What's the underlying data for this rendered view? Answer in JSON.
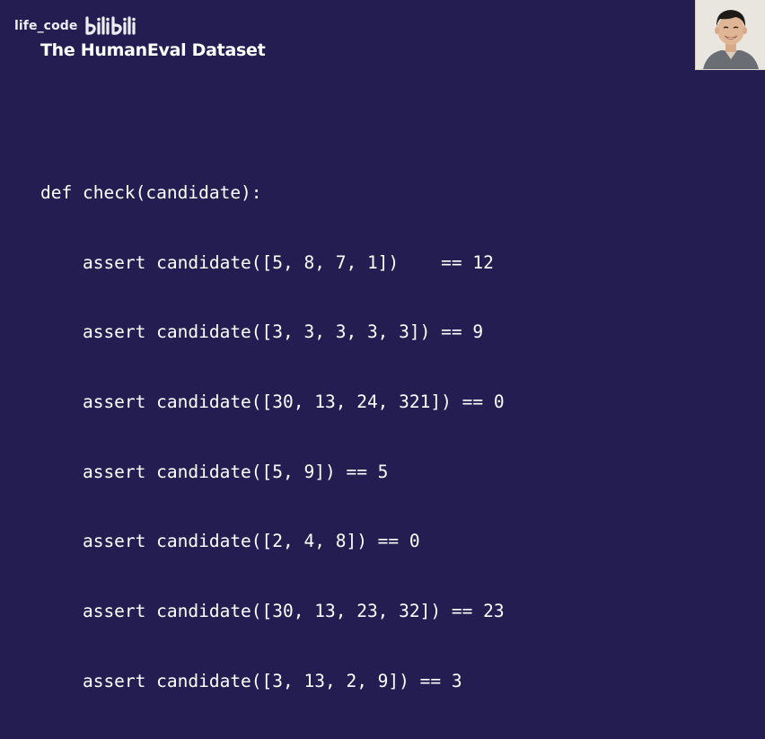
{
  "watermark": {
    "channel": "life_code",
    "logo_text": "bilibili"
  },
  "slide": {
    "title": "The HumanEval Dataset"
  },
  "code": {
    "lines": [
      "def check(candidate):",
      "    assert candidate([5, 8, 7, 1])    == 12",
      "    assert candidate([3, 3, 3, 3, 3]) == 9",
      "    assert candidate([30, 13, 24, 321]) == 0",
      "    assert candidate([5, 9]) == 5",
      "    assert candidate([2, 4, 8]) == 0",
      "    assert candidate([30, 13, 23, 32]) == 23",
      "    assert candidate([3, 13, 2, 9]) == 3"
    ]
  },
  "colors": {
    "background": "#241d52",
    "text": "#ffffff"
  },
  "icons": {
    "logo": "bilibili-logo",
    "presenter": "presenter-avatar"
  }
}
